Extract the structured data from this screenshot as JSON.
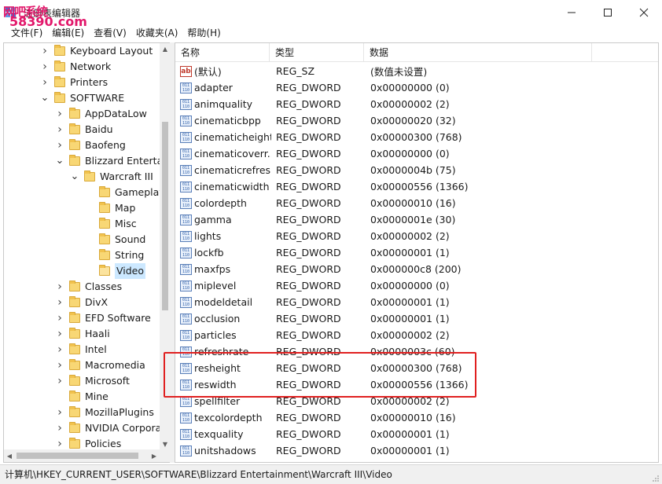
{
  "window": {
    "title": "注册表编辑器",
    "watermark_top": "网吧系统",
    "watermark_bottom": "58390.com"
  },
  "menu": [
    "文件(F)",
    "编辑(E)",
    "查看(V)",
    "收藏夹(A)",
    "帮助(H)"
  ],
  "tree": [
    {
      "label": "Keyboard Layout",
      "level": 1,
      "arrow": "right"
    },
    {
      "label": "Network",
      "level": 1,
      "arrow": "right"
    },
    {
      "label": "Printers",
      "level": 1,
      "arrow": "right"
    },
    {
      "label": "SOFTWARE",
      "level": 1,
      "arrow": "down"
    },
    {
      "label": "AppDataLow",
      "level": 2,
      "arrow": "right"
    },
    {
      "label": "Baidu",
      "level": 2,
      "arrow": "right"
    },
    {
      "label": "Baofeng",
      "level": 2,
      "arrow": "right"
    },
    {
      "label": "Blizzard Entertai",
      "level": 2,
      "arrow": "down"
    },
    {
      "label": "Warcraft III",
      "level": 3,
      "arrow": "down"
    },
    {
      "label": "Gameplay",
      "level": 4,
      "arrow": "none"
    },
    {
      "label": "Map",
      "level": 4,
      "arrow": "none"
    },
    {
      "label": "Misc",
      "level": 4,
      "arrow": "none"
    },
    {
      "label": "Sound",
      "level": 4,
      "arrow": "none"
    },
    {
      "label": "String",
      "level": 4,
      "arrow": "none"
    },
    {
      "label": "Video",
      "level": 4,
      "arrow": "none",
      "selected": true
    },
    {
      "label": "Classes",
      "level": 2,
      "arrow": "right"
    },
    {
      "label": "DivX",
      "level": 2,
      "arrow": "right"
    },
    {
      "label": "EFD Software",
      "level": 2,
      "arrow": "right"
    },
    {
      "label": "Haali",
      "level": 2,
      "arrow": "right"
    },
    {
      "label": "Intel",
      "level": 2,
      "arrow": "right"
    },
    {
      "label": "Macromedia",
      "level": 2,
      "arrow": "right"
    },
    {
      "label": "Microsoft",
      "level": 2,
      "arrow": "right"
    },
    {
      "label": "Mine",
      "level": 2,
      "arrow": "none"
    },
    {
      "label": "MozillaPlugins",
      "level": 2,
      "arrow": "right"
    },
    {
      "label": "NVIDIA Corpora",
      "level": 2,
      "arrow": "right"
    },
    {
      "label": "Policies",
      "level": 2,
      "arrow": "right"
    }
  ],
  "columns": {
    "name": "名称",
    "type": "类型",
    "data": "数据"
  },
  "values": [
    {
      "name": "(默认)",
      "type": "REG_SZ",
      "data": "(数值未设置)",
      "icon": "ab"
    },
    {
      "name": "adapter",
      "type": "REG_DWORD",
      "data": "0x00000000 (0)",
      "icon": "bin"
    },
    {
      "name": "animquality",
      "type": "REG_DWORD",
      "data": "0x00000002 (2)",
      "icon": "bin"
    },
    {
      "name": "cinematicbpp",
      "type": "REG_DWORD",
      "data": "0x00000020 (32)",
      "icon": "bin"
    },
    {
      "name": "cinematicheight",
      "type": "REG_DWORD",
      "data": "0x00000300 (768)",
      "icon": "bin"
    },
    {
      "name": "cinematicoverr...",
      "type": "REG_DWORD",
      "data": "0x00000000 (0)",
      "icon": "bin"
    },
    {
      "name": "cinematicrefresh",
      "type": "REG_DWORD",
      "data": "0x0000004b (75)",
      "icon": "bin"
    },
    {
      "name": "cinematicwidth",
      "type": "REG_DWORD",
      "data": "0x00000556 (1366)",
      "icon": "bin"
    },
    {
      "name": "colordepth",
      "type": "REG_DWORD",
      "data": "0x00000010 (16)",
      "icon": "bin"
    },
    {
      "name": "gamma",
      "type": "REG_DWORD",
      "data": "0x0000001e (30)",
      "icon": "bin"
    },
    {
      "name": "lights",
      "type": "REG_DWORD",
      "data": "0x00000002 (2)",
      "icon": "bin"
    },
    {
      "name": "lockfb",
      "type": "REG_DWORD",
      "data": "0x00000001 (1)",
      "icon": "bin"
    },
    {
      "name": "maxfps",
      "type": "REG_DWORD",
      "data": "0x000000c8 (200)",
      "icon": "bin"
    },
    {
      "name": "miplevel",
      "type": "REG_DWORD",
      "data": "0x00000000 (0)",
      "icon": "bin"
    },
    {
      "name": "modeldetail",
      "type": "REG_DWORD",
      "data": "0x00000001 (1)",
      "icon": "bin"
    },
    {
      "name": "occlusion",
      "type": "REG_DWORD",
      "data": "0x00000001 (1)",
      "icon": "bin"
    },
    {
      "name": "particles",
      "type": "REG_DWORD",
      "data": "0x00000002 (2)",
      "icon": "bin"
    },
    {
      "name": "refreshrate",
      "type": "REG_DWORD",
      "data": "0x0000003c (60)",
      "icon": "bin"
    },
    {
      "name": "resheight",
      "type": "REG_DWORD",
      "data": "0x00000300 (768)",
      "icon": "bin"
    },
    {
      "name": "reswidth",
      "type": "REG_DWORD",
      "data": "0x00000556 (1366)",
      "icon": "bin"
    },
    {
      "name": "spellfilter",
      "type": "REG_DWORD",
      "data": "0x00000002 (2)",
      "icon": "bin"
    },
    {
      "name": "texcolordepth",
      "type": "REG_DWORD",
      "data": "0x00000010 (16)",
      "icon": "bin"
    },
    {
      "name": "texquality",
      "type": "REG_DWORD",
      "data": "0x00000001 (1)",
      "icon": "bin"
    },
    {
      "name": "unitshadows",
      "type": "REG_DWORD",
      "data": "0x00000001 (1)",
      "icon": "bin"
    }
  ],
  "status": {
    "path": "计算机\\HKEY_CURRENT_USER\\SOFTWARE\\Blizzard Entertainment\\Warcraft III\\Video"
  },
  "icons": {
    "app": "registry-editor-icon",
    "minimize": "minimize-icon",
    "maximize": "maximize-icon",
    "close": "close-icon",
    "folder": "folder-icon",
    "string_value": "string-value-icon",
    "binary_value": "binary-value-icon"
  },
  "colors": {
    "highlight_border": "#e02020",
    "selection": "#cce8ff",
    "folder": "#f8d775"
  }
}
